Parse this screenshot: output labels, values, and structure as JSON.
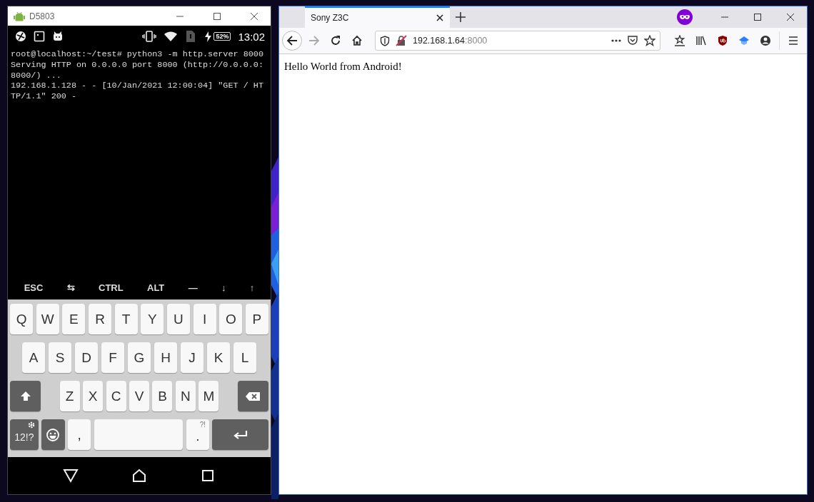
{
  "phone_window": {
    "title": "D5803",
    "status_bar": {
      "battery": "52%",
      "time": "13:02"
    },
    "terminal_lines": [
      "root@localhost:~/test# python3 -m http.server 8000",
      "Serving HTTP on 0.0.0.0 port 8000 (http://0.0.0.0:",
      "8000/) ...",
      "192.168.1.128 - - [10/Jan/2021 12:00:04] \"GET / HT",
      "TP/1.1\" 200 -"
    ],
    "extra_keys": [
      "ESC",
      "⇆",
      "CTRL",
      "ALT",
      "—",
      "↓",
      "↑"
    ],
    "keyboard_rows": [
      {
        "keys": [
          {
            "kind": "letter",
            "label": "Q"
          },
          {
            "kind": "letter",
            "label": "W"
          },
          {
            "kind": "letter",
            "label": "E"
          },
          {
            "kind": "letter",
            "label": "R"
          },
          {
            "kind": "letter",
            "label": "T"
          },
          {
            "kind": "letter",
            "label": "Y"
          },
          {
            "kind": "letter",
            "label": "U"
          },
          {
            "kind": "letter",
            "label": "I"
          },
          {
            "kind": "letter",
            "label": "O"
          },
          {
            "kind": "letter",
            "label": "P"
          }
        ]
      },
      {
        "keys": [
          {
            "kind": "letter",
            "label": "A"
          },
          {
            "kind": "letter",
            "label": "S"
          },
          {
            "kind": "letter",
            "label": "D"
          },
          {
            "kind": "letter",
            "label": "F"
          },
          {
            "kind": "letter",
            "label": "G"
          },
          {
            "kind": "letter",
            "label": "H"
          },
          {
            "kind": "letter",
            "label": "J"
          },
          {
            "kind": "letter",
            "label": "K"
          },
          {
            "kind": "letter",
            "label": "L"
          }
        ]
      },
      {
        "keys": [
          {
            "kind": "shift"
          },
          {
            "kind": "letter",
            "label": "Z"
          },
          {
            "kind": "letter",
            "label": "X"
          },
          {
            "kind": "letter",
            "label": "C"
          },
          {
            "kind": "letter",
            "label": "V"
          },
          {
            "kind": "letter",
            "label": "B"
          },
          {
            "kind": "letter",
            "label": "N"
          },
          {
            "kind": "letter",
            "label": "M"
          },
          {
            "kind": "backspace"
          }
        ]
      },
      {
        "keys": [
          {
            "kind": "symbols",
            "label": "12!?"
          },
          {
            "kind": "emoji"
          },
          {
            "kind": "letter",
            "label": ","
          },
          {
            "kind": "space"
          },
          {
            "kind": "period",
            "label": ".",
            "hint": "?!"
          },
          {
            "kind": "enter"
          }
        ]
      }
    ]
  },
  "browser_window": {
    "tabs": [
      {
        "label": "Sony Z3C",
        "selected": true
      }
    ],
    "address_bar": {
      "host": "192.168.1.64",
      "port": ":8000"
    },
    "page_text": "Hello World from Android!"
  }
}
